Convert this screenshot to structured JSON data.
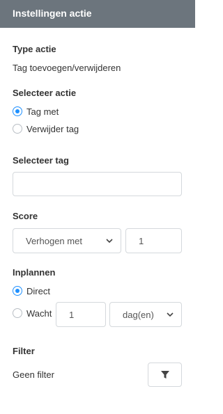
{
  "header": {
    "title": "Instellingen actie"
  },
  "type_actie": {
    "label": "Type actie",
    "value": "Tag toevoegen/verwijderen"
  },
  "selecteer_actie": {
    "label": "Selecteer actie",
    "options": [
      {
        "label": "Tag met",
        "checked": true
      },
      {
        "label": "Verwijder tag",
        "checked": false
      }
    ]
  },
  "selecteer_tag": {
    "label": "Selecteer tag",
    "value": ""
  },
  "score": {
    "label": "Score",
    "mode": "Verhogen met",
    "amount": "1"
  },
  "inplannen": {
    "label": "Inplannen",
    "direct_label": "Direct",
    "wacht_label": "Wacht",
    "wacht_amount": "1",
    "wacht_unit": "dag(en)",
    "selected": "direct"
  },
  "filter": {
    "label": "Filter",
    "value": "Geen filter",
    "icon": "filter-icon"
  },
  "colors": {
    "header_bg": "#6c757d",
    "accent": "#1e90ff"
  }
}
